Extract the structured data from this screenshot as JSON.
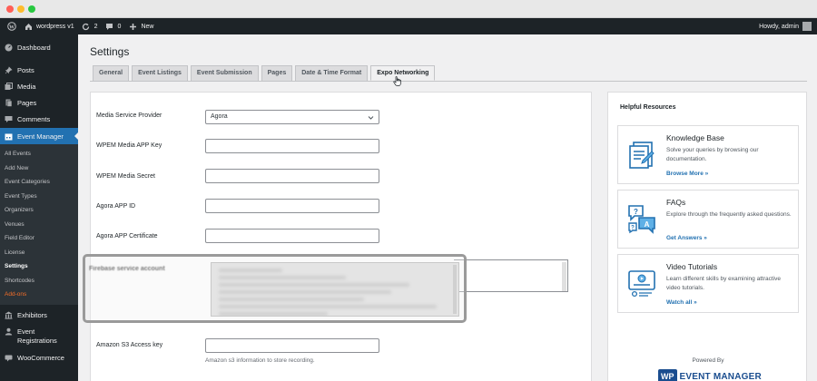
{
  "adminbar": {
    "site_name": "wordpress v1",
    "updates_count": "2",
    "comments_count": "0",
    "new_label": "New",
    "howdy": "Howdy, admin"
  },
  "sidebar": {
    "dashboard": "Dashboard",
    "posts": "Posts",
    "media": "Media",
    "pages": "Pages",
    "comments": "Comments",
    "event_manager": "Event Manager",
    "submenu": [
      "All Events",
      "Add New",
      "Event Categories",
      "Event Types",
      "Organizers",
      "Venues",
      "Field Editor",
      "License",
      "Settings",
      "Shortcodes",
      "Add-ons"
    ],
    "exhibitors": "Exhibitors",
    "event_registrations_1": "Event",
    "event_registrations_2": "Registrations",
    "woocommerce": "WooCommerce"
  },
  "page": {
    "title": "Settings",
    "tabs": [
      "General",
      "Event Listings",
      "Event Submission",
      "Pages",
      "Date & Time Format",
      "Expo Networking"
    ]
  },
  "form": {
    "media_provider_label": "Media Service Provider",
    "media_provider_value": "Agora",
    "app_key_label": "WPEM Media APP Key",
    "secret_label": "WPEM Media Secret",
    "agora_app_id_label": "Agora APP ID",
    "agora_cert_label": "Agora APP Certificate",
    "firebase_label": "Firebase service account",
    "s3_access_label": "Amazon S3 Access key",
    "s3_hint": "Amazon s3 information to store recording."
  },
  "resources": {
    "title": "Helpful Resources",
    "kb_title": "Knowledge Base",
    "kb_desc": "Solve your queries by browsing our documentation.",
    "kb_link": "Browse More »",
    "faq_title": "FAQs",
    "faq_desc": "Explore through the frequently asked questions.",
    "faq_link": "Get Answers »",
    "video_title": "Video Tutorials",
    "video_desc": "Learn different skills by examining attractive video tutorials.",
    "video_link": "Watch all »",
    "powered_by": "Powered By",
    "logo_wp": "WP",
    "logo_text": "EVENT MANAGER"
  },
  "colors": {
    "accent": "#2271b1",
    "adminbar": "#1d2327",
    "addon": "#f56e28"
  }
}
